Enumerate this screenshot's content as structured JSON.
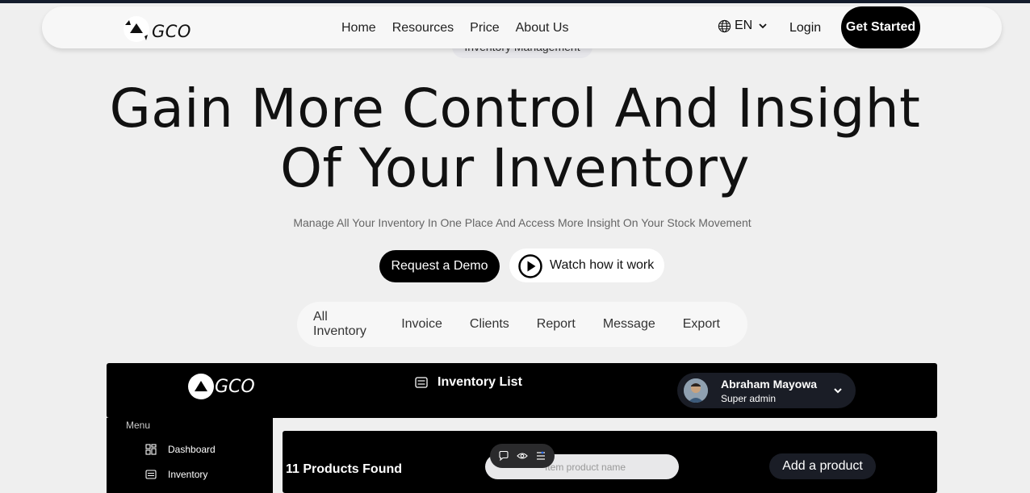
{
  "nav": {
    "logo_text": "GCO",
    "links": [
      "Home",
      "Resources",
      "Price",
      "About Us"
    ],
    "language": "EN",
    "login_label": "Login",
    "cta_label": "Get Started"
  },
  "hero": {
    "tag": "Inventory Management",
    "title_line1": "Gain More Control And Insight",
    "title_line2": "Of Your Inventory",
    "subtitle": "Manage All Your Inventory In One Place And Access More Insight On Your Stock Movement",
    "demo_label": "Request a Demo",
    "watch_label": "Watch how it work"
  },
  "tabs": [
    "All Inventory",
    "Invoice",
    "Clients",
    "Report",
    "Message",
    "Export"
  ],
  "dashboard": {
    "logo_text": "GCO",
    "page_title": "Inventory List",
    "user": {
      "name": "Abraham Mayowa",
      "role": "Super admin"
    },
    "menu_label": "Menu",
    "menu_items": [
      "Dashboard",
      "Inventory"
    ],
    "products_found": "11 Products Found",
    "search_placeholder": "Item product name",
    "add_product_label": "Add a product"
  },
  "colors": {
    "background": "#efefef",
    "navbar": "#f7f7f7",
    "primary_button": "#000000",
    "dashboard_dark": "#000000",
    "pill_dark": "#1a1d26"
  }
}
